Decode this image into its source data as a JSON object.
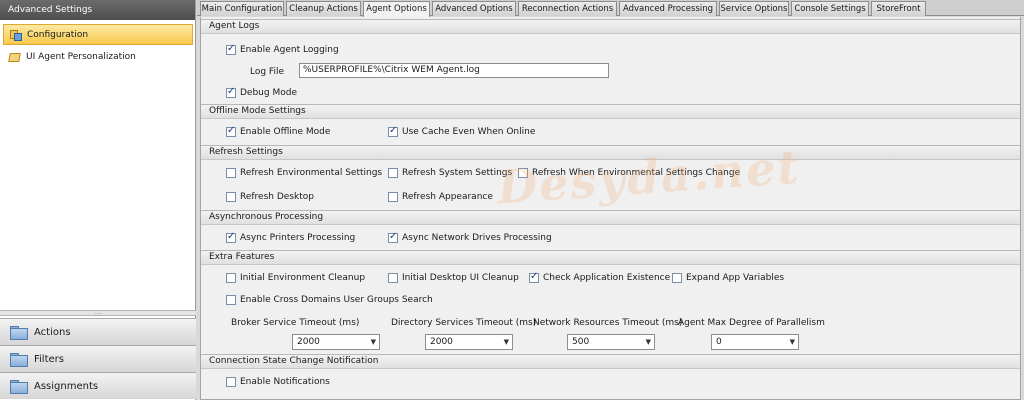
{
  "left_pane": {
    "header": "Advanced Settings",
    "tree": [
      {
        "label": "Configuration",
        "selected": true,
        "icon": "configuration-icon"
      },
      {
        "label": "UI Agent Personalization",
        "selected": false,
        "icon": "personalization-icon"
      }
    ],
    "splitter_grip": "....",
    "nav": [
      {
        "label": "Actions",
        "icon": "folder-icon"
      },
      {
        "label": "Filters",
        "icon": "folder-icon"
      },
      {
        "label": "Assignments",
        "icon": "folder-icon"
      }
    ]
  },
  "tabs": [
    {
      "label": "Main Configuration",
      "active": false
    },
    {
      "label": "Cleanup Actions",
      "active": false
    },
    {
      "label": "Agent Options",
      "active": true
    },
    {
      "label": "Advanced Options",
      "active": false
    },
    {
      "label": "Reconnection Actions",
      "active": false
    },
    {
      "label": "Advanced Processing",
      "active": false
    },
    {
      "label": "Service Options",
      "active": false
    },
    {
      "label": "Console Settings",
      "active": false
    },
    {
      "label": "StoreFront",
      "active": false
    }
  ],
  "sections": {
    "agent_logs": {
      "title": "Agent Logs",
      "enable_logging": {
        "label": "Enable Agent Logging",
        "checked": true
      },
      "log_file_label": "Log File",
      "log_file_value": "%USERPROFILE%\\Citrix WEM Agent.log",
      "debug_mode": {
        "label": "Debug Mode",
        "checked": true
      }
    },
    "offline_mode": {
      "title": "Offline Mode Settings",
      "enable_offline": {
        "label": "Enable Offline Mode",
        "checked": true
      },
      "use_cache": {
        "label": "Use Cache Even When Online",
        "checked": true
      }
    },
    "refresh": {
      "title": "Refresh Settings",
      "env": {
        "label": "Refresh Environmental Settings",
        "checked": false
      },
      "system": {
        "label": "Refresh System Settings",
        "checked": false
      },
      "when_env_change": {
        "label": "Refresh When Environmental Settings Change",
        "checked": false
      },
      "desktop": {
        "label": "Refresh Desktop",
        "checked": false
      },
      "appearance": {
        "label": "Refresh Appearance",
        "checked": false
      }
    },
    "async": {
      "title": "Asynchronous Processing",
      "printers": {
        "label": "Async Printers Processing",
        "checked": true
      },
      "network_drives": {
        "label": "Async Network Drives Processing",
        "checked": true
      }
    },
    "extra": {
      "title": "Extra Features",
      "initial_cleanup": {
        "label": "Initial Environment Cleanup",
        "checked": false
      },
      "initial_desktop_ui": {
        "label": "Initial Desktop UI Cleanup",
        "checked": false
      },
      "check_app": {
        "label": "Check Application Existence",
        "checked": true
      },
      "expand_vars": {
        "label": "Expand App Variables",
        "checked": false
      },
      "cross_domains": {
        "label": "Enable Cross Domains User Groups Search",
        "checked": false
      },
      "broker_timeout": {
        "label": "Broker Service Timeout  (ms)",
        "value": "2000"
      },
      "directory_timeout": {
        "label": "Directory Services Timeout  (ms)",
        "value": "2000"
      },
      "network_timeout": {
        "label": "Network Resources Timeout  (ms)",
        "value": "500"
      },
      "parallelism": {
        "label": "Agent Max Degree of Parallelism",
        "value": "0"
      }
    },
    "connection_state": {
      "title": "Connection State Change Notification",
      "enable_notifications": {
        "label": "Enable Notifications",
        "checked": false
      }
    }
  },
  "watermark": "Desyda.net",
  "colors": {
    "selected_item": "#f7c94d",
    "left_header": "#5a5a5a",
    "panel_bg": "#f0f0f0",
    "check_mark": "#1b3f7a"
  }
}
